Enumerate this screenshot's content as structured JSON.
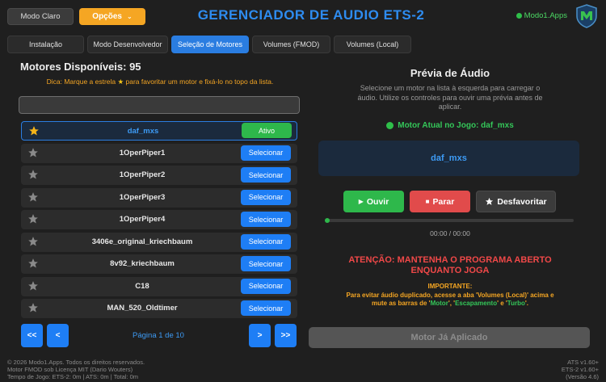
{
  "header": {
    "mode_button": "Modo Claro",
    "options_button": "Opções",
    "options_caret": "⌄",
    "title": "GERENCIADOR DE AUDIO ETS-2",
    "brand": "Modo1.Apps"
  },
  "tabs": [
    {
      "label": "Instalação",
      "active": false
    },
    {
      "label": "Modo Desenvolvedor",
      "active": false
    },
    {
      "label": "Seleção de Motores",
      "active": true
    },
    {
      "label": "Volumes (FMOD)",
      "active": false
    },
    {
      "label": "Volumes (Local)",
      "active": false
    }
  ],
  "left": {
    "title": "Motores Disponíveis: 95",
    "hint_prefix": "Dica: Marque a estrela",
    "hint_star": "★",
    "hint_suffix": "para favoritar um motor e fixá-lo no topo da lista.",
    "search_value": "",
    "engines": [
      {
        "name": "daf_mxs",
        "action": "Ativo",
        "active": true,
        "favorite": true
      },
      {
        "name": "1OperPiper1",
        "action": "Selecionar",
        "active": false,
        "favorite": false
      },
      {
        "name": "1OperPiper2",
        "action": "Selecionar",
        "active": false,
        "favorite": false
      },
      {
        "name": "1OperPiper3",
        "action": "Selecionar",
        "active": false,
        "favorite": false
      },
      {
        "name": "1OperPiper4",
        "action": "Selecionar",
        "active": false,
        "favorite": false
      },
      {
        "name": "3406e_original_kriechbaum",
        "action": "Selecionar",
        "active": false,
        "favorite": false
      },
      {
        "name": "8v92_kriechbaum",
        "action": "Selecionar",
        "active": false,
        "favorite": false
      },
      {
        "name": "C18",
        "action": "Selecionar",
        "active": false,
        "favorite": false
      },
      {
        "name": "MAN_520_Oldtimer",
        "action": "Selecionar",
        "active": false,
        "favorite": false
      }
    ],
    "pager": {
      "first": "<<",
      "prev": "<",
      "info": "Página 1 de 10",
      "next": ">",
      "last": ">>"
    }
  },
  "right": {
    "title": "Prévia de Áudio",
    "description": "Selecione um motor na lista à esquerda para carregar o áudio. Utilize os controles para ouvir uma prévia antes de aplicar.",
    "current_engine": "Motor Atual no Jogo: daf_mxs",
    "preview_name": "daf_mxs",
    "play_label": "Ouvir",
    "stop_label": "Parar",
    "unfav_label": "Desfavoritar",
    "progress_fraction": 0.0,
    "time": "00:00 / 00:00",
    "warning": "ATENÇÃO: MANTENHA O PROGRAMA ABERTO ENQUANTO JOGA",
    "important_title": "IMPORTANTE:",
    "important_1": "Para evitar áudio duplicado, acesse a aba 'Volumes (Local)' acima e mute as barras de '",
    "important_motor": "Motor",
    "important_2": "', '",
    "important_escape": "Escapamento",
    "important_3": "' e '",
    "important_turbo": "Turbo",
    "important_4": "'.",
    "apply_label": "Motor Já Aplicado"
  },
  "footer": {
    "line1": "© 2026 Modo1.Apps. Todos os direitos reservados.",
    "line2": "Motor FMOD sob Licença MIT (Dario Wouters)",
    "line3": "Tempo de Jogo: ETS-2: 0m | ATS: 0m | Total: 0m",
    "right1": "ATS v1.60+",
    "right2": "ETS-2 v1.60+",
    "right3": "(Versão 4.6)"
  },
  "colors": {
    "accent": "#2a7de1",
    "orange": "#f5a623",
    "green": "#2eb84b",
    "red": "#e14b4b"
  }
}
